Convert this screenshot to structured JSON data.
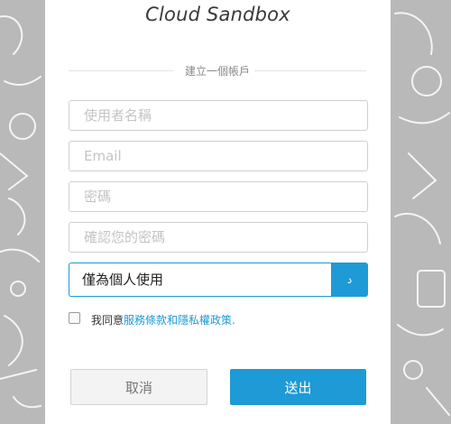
{
  "app": {
    "title": "Cloud Sandbox"
  },
  "form": {
    "section_label": "建立一個帳戶",
    "username": {
      "placeholder": "使用者名稱",
      "value": ""
    },
    "email": {
      "placeholder": "Email",
      "value": ""
    },
    "password": {
      "placeholder": "密碼",
      "value": ""
    },
    "confirm_password": {
      "placeholder": "確認您的密碼",
      "value": ""
    },
    "usage_select": {
      "selected": "僅為個人使用",
      "button_glyph": "د"
    },
    "agreement": {
      "checked": false,
      "prefix": "我同意",
      "link_text": "服務條款和隱私權政策",
      "suffix": "."
    },
    "buttons": {
      "cancel_label": "取消",
      "submit_label": "送出"
    }
  },
  "colors": {
    "accent": "#1e9ad6",
    "background_pattern": "#b9b9b9",
    "panel": "#ffffff"
  }
}
